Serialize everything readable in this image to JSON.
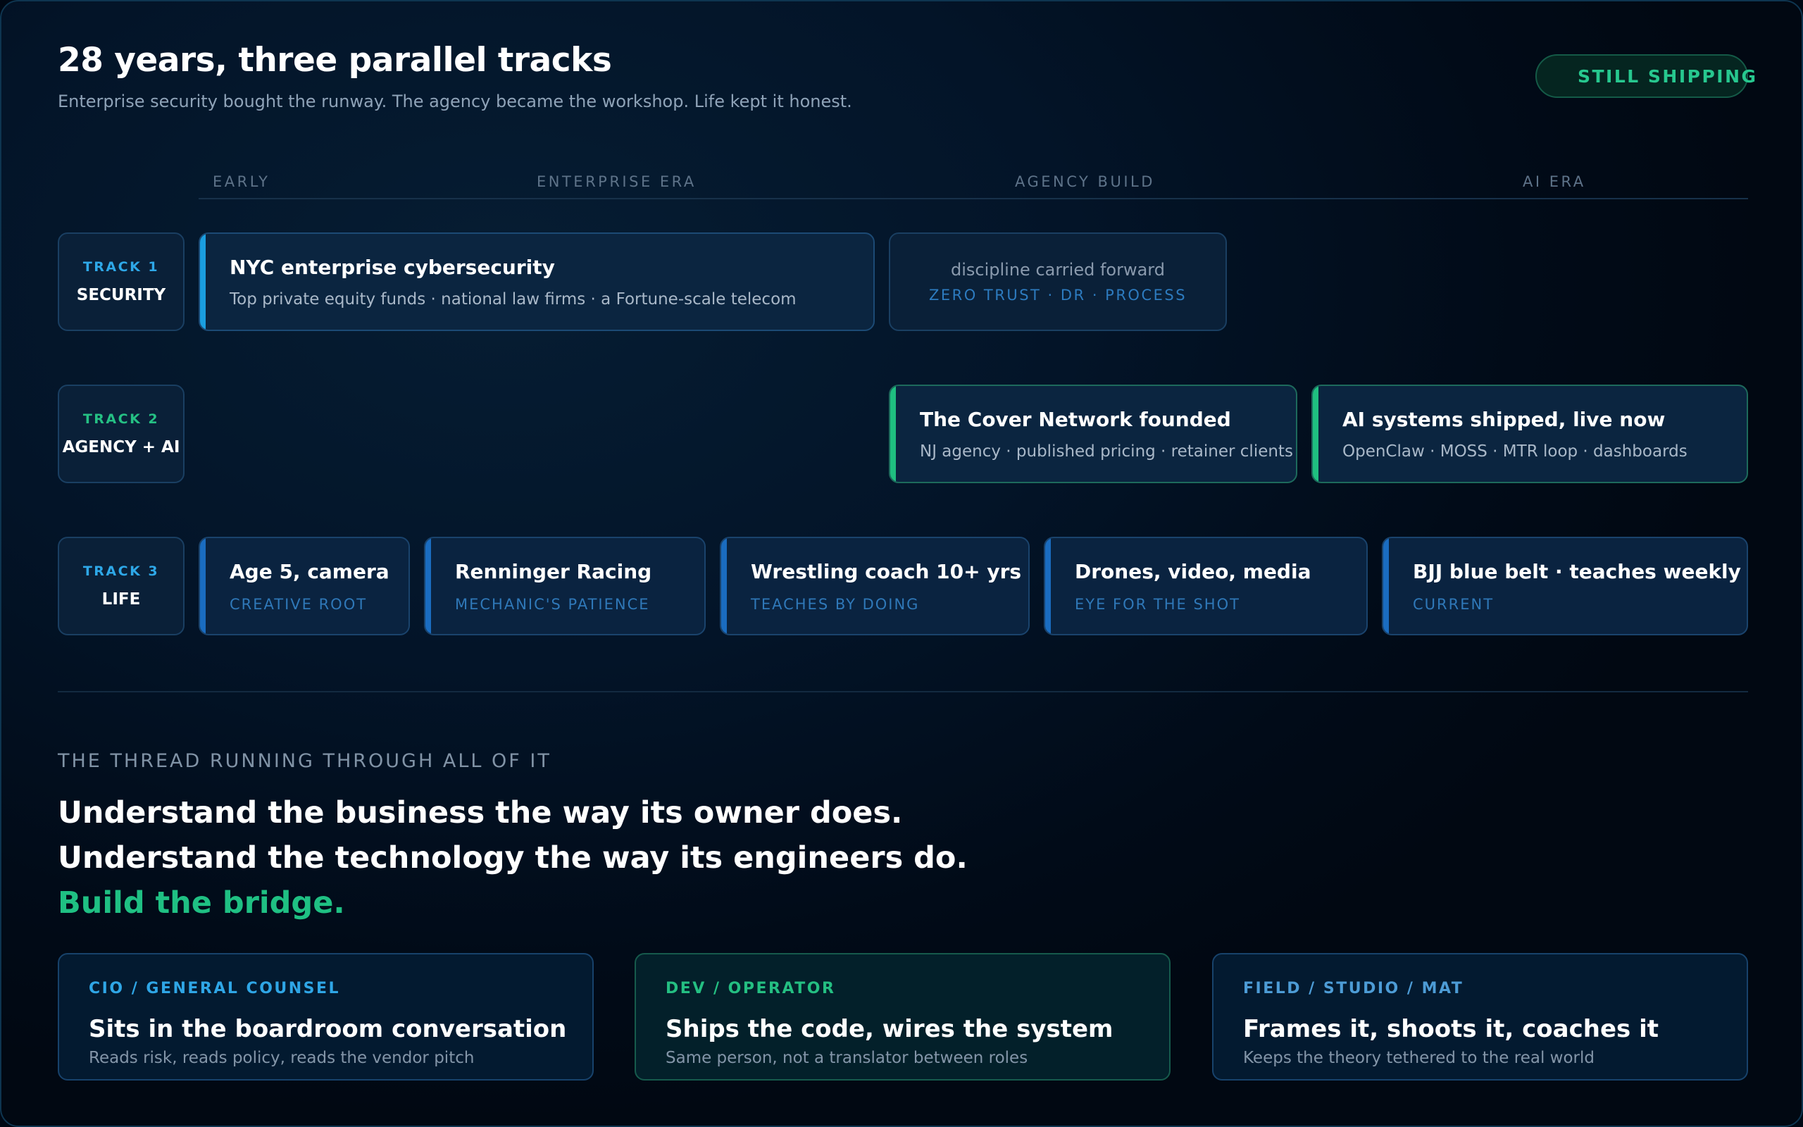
{
  "header": {
    "title": "28 years, three parallel tracks",
    "subtitle": "Enterprise security bought the runway. The agency became the workshop. Life kept it honest.",
    "status": "STILL SHIPPING"
  },
  "eras": [
    "EARLY",
    "ENTERPRISE ERA",
    "AGENCY BUILD",
    "AI ERA"
  ],
  "tracks": [
    {
      "number": "TRACK 1",
      "name": "SECURITY",
      "cards": [
        {
          "title": "NYC enterprise cybersecurity",
          "desc": "Top private equity funds · national law firms · a Fortune-scale telecom"
        }
      ],
      "carry": {
        "text": "discipline carried forward",
        "tag": "ZERO TRUST · DR · PROCESS"
      }
    },
    {
      "number": "TRACK 2",
      "name": "AGENCY + AI",
      "cards": [
        {
          "title": "The Cover Network founded",
          "desc": "NJ agency · published pricing · retainer clients"
        },
        {
          "title": "AI systems shipped, live now",
          "desc": "OpenClaw · MOSS · MTR loop · dashboards"
        }
      ]
    },
    {
      "number": "TRACK 3",
      "name": "LIFE",
      "cards": [
        {
          "title": "Age 5, camera",
          "tag": "CREATIVE ROOT"
        },
        {
          "title": "Renninger Racing",
          "tag": "MECHANIC'S PATIENCE"
        },
        {
          "title": "Wrestling coach 10+ yrs",
          "tag": "TEACHES BY DOING"
        },
        {
          "title": "Drones, video, media",
          "tag": "EYE FOR THE SHOT"
        },
        {
          "title": "BJJ blue belt · teaches weekly",
          "tag": "CURRENT"
        }
      ]
    }
  ],
  "thread": {
    "label": "THE THREAD RUNNING THROUGH ALL OF IT",
    "lines": [
      "Understand the business the way its owner does.",
      "Understand the technology the way its engineers do.",
      "Build the bridge."
    ]
  },
  "roles": [
    {
      "label": "CIO / GENERAL COUNSEL",
      "title": "Sits in the boardroom conversation",
      "desc": "Reads risk, reads policy, reads the vendor pitch"
    },
    {
      "label": "DEV / OPERATOR",
      "title": "Ships the code, wires the system",
      "desc": "Same person, not a translator between roles"
    },
    {
      "label": "FIELD / STUDIO / MAT",
      "title": "Frames it, shoots it, coaches it",
      "desc": "Keeps the theory tethered to the real world"
    }
  ],
  "colors": {
    "accent_blue": "#1a9ee0",
    "accent_green": "#1fc083",
    "life_blue": "#1a6cc0",
    "background": "#031428"
  }
}
